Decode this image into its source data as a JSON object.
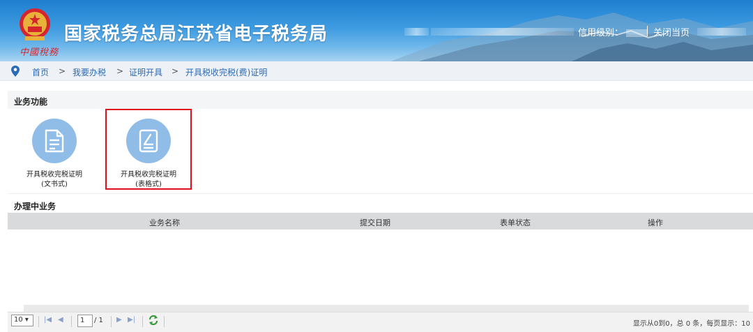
{
  "header": {
    "brand": "中國稅務",
    "title": "国家税务总局江苏省电子税务局",
    "credit_label": "信用级别：",
    "close_label": "关闭当页"
  },
  "breadcrumb": [
    "首页",
    "我要办税",
    "证明开具",
    "开具税收完税(费)证明"
  ],
  "breadcrumb_sep": ">",
  "functions": {
    "title": "业务功能",
    "tiles": [
      {
        "line1": "开具税收完税证明",
        "line2": "(文书式)",
        "icon": "document-icon"
      },
      {
        "line1": "开具税收完税证明",
        "line2": "(表格式)",
        "icon": "form-edit-icon"
      }
    ]
  },
  "pending": {
    "title": "办理中业务",
    "columns": [
      "业务名称",
      "提交日期",
      "表单状态",
      "操作"
    ]
  },
  "pager": {
    "page_size": "10",
    "current_page": "1",
    "total_pages": "/ 1",
    "info": "显示从0到0，总 0 条，每页显示：10"
  },
  "colors": {
    "accent_blue": "#2a6bb8",
    "icon_circle": "#8fbde8",
    "highlight_red": "#e0111c"
  }
}
